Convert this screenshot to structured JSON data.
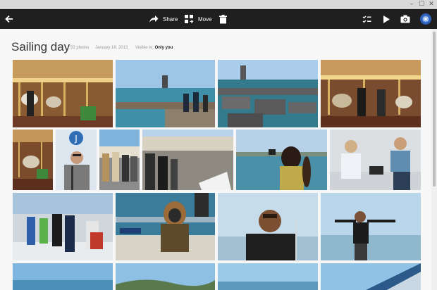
{
  "toolbar": {
    "share_label": "Share",
    "move_label": "Move"
  },
  "album": {
    "title": "Sailing day",
    "photo_count": "53 photos",
    "date": "January 18, 2013",
    "visibility_prefix": "Visible to:",
    "visibility_value": "Only you"
  },
  "photos": [
    "Carousel with horses",
    "Pier and harbor",
    "Dock floats",
    "Carousel close-up",
    "Carousel booth",
    "Man smiling by a sign",
    "People on dock",
    "Group on pier",
    "Boat at marina",
    "Woman taking photo",
    "Man and woman on boat",
    "Group on deck",
    "Person in parka",
    "Man smiling on water",
    "Man with arms out",
    "Ocean view",
    "Ocean and hills",
    "Ocean view 2",
    "Boat sail"
  ],
  "colors": {
    "toolbar": "#1f1f1f",
    "background": "#f7f7f7",
    "accent": "#3a7bd5"
  }
}
